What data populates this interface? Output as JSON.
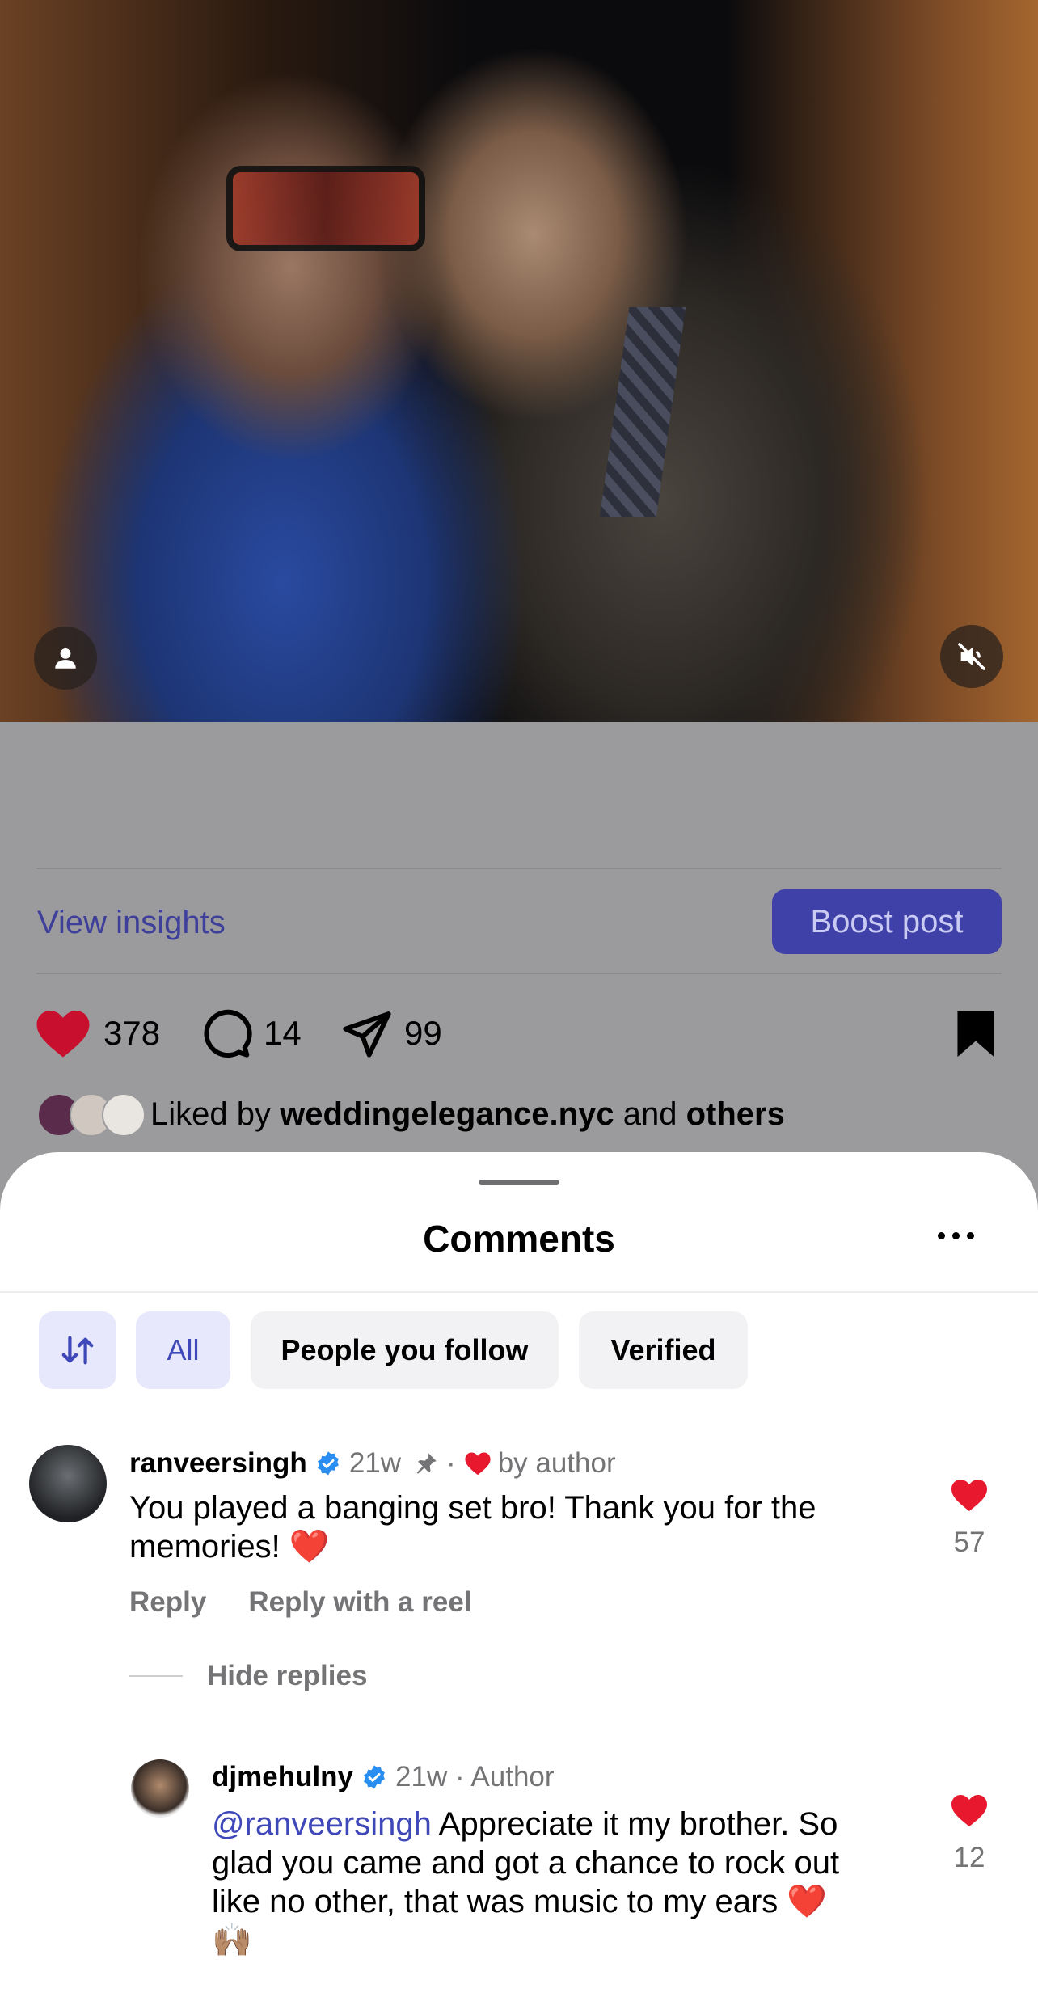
{
  "post": {
    "view_insights": "View insights",
    "boost_post": "Boost post",
    "likes": "378",
    "comments": "14",
    "shares": "99",
    "liked_by_prefix": "Liked by",
    "liked_by_user": "weddingelegance.nyc",
    "liked_by_and": "and",
    "liked_by_others": "others"
  },
  "sheet": {
    "title": "Comments",
    "filters": [
      "All",
      "People you follow",
      "Verified"
    ]
  },
  "comments": [
    {
      "username": "ranveersingh",
      "time": "21w",
      "separator": "·",
      "tag": "by author",
      "text_1": "You played a banging set bro! Thank you for the",
      "text_2": "memories! ❤️",
      "like_count": "57",
      "actions": [
        "Reply",
        "Reply with a reel"
      ]
    }
  ],
  "hide_replies": "Hide replies",
  "reply": {
    "username": "djmehulny",
    "time": "21w · Author",
    "mention": "@ranveersingh",
    "text_1": " Appreciate it my brother. So",
    "text_2": "glad you came and got a chance to rock out",
    "text_3": "like no other, that was music to my ears ❤️",
    "text_4": "🙌🏽",
    "like_count": "12"
  },
  "colors": {
    "accent": "#3f48b8",
    "heart": "#e8192e",
    "verified": "#2a8ef0",
    "dim_overlay": "#9b9b9d"
  }
}
